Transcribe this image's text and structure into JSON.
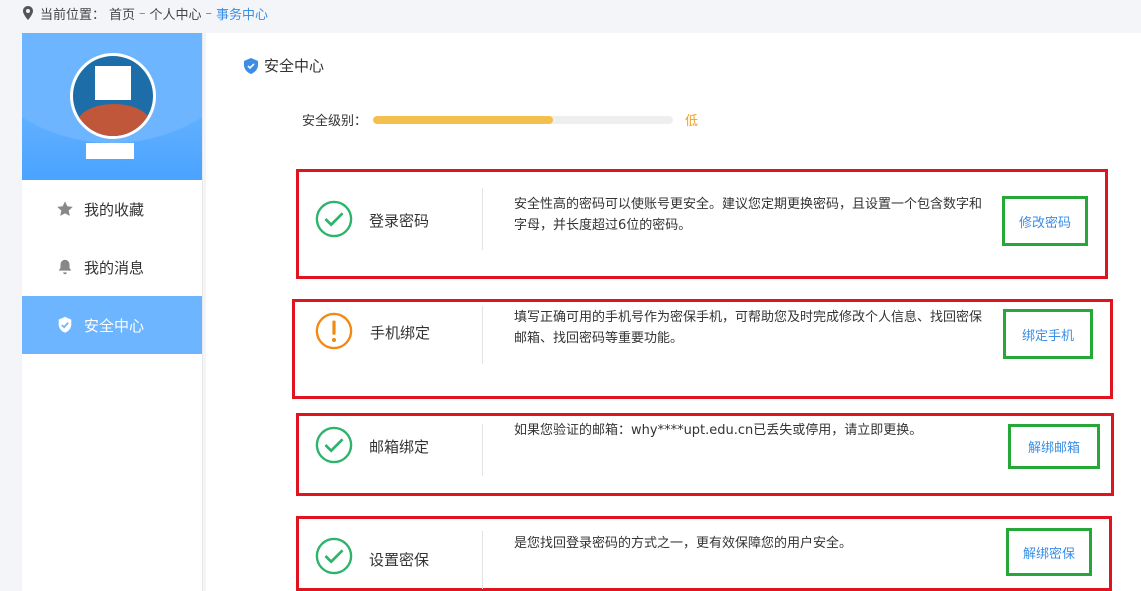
{
  "breadcrumb": {
    "prefix": "当前位置：",
    "home": "首页",
    "sep": "–",
    "personal": "个人中心",
    "current": "事务中心"
  },
  "sidebar": {
    "items": [
      {
        "label": "我的收藏",
        "icon": "star-icon"
      },
      {
        "label": "我的消息",
        "icon": "bell-icon"
      },
      {
        "label": "安全中心",
        "icon": "shield-icon"
      }
    ]
  },
  "main": {
    "title": "安全中心",
    "level_label": "安全级别：",
    "level_value": "低",
    "level_percent": 60,
    "items": [
      {
        "name": "登录密码",
        "status": "ok",
        "desc": "安全性高的密码可以使账号更安全。建议您定期更换密码，且设置一个包含数字和字母，并长度超过6位的密码。",
        "action": "修改密码"
      },
      {
        "name": "手机绑定",
        "status": "warning",
        "desc": "填写正确可用的手机号作为密保手机，可帮助您及时完成修改个人信息、找回密保邮箱、找回密码等重要功能。",
        "action": "绑定手机"
      },
      {
        "name": "邮箱绑定",
        "status": "ok",
        "desc": "如果您验证的邮箱：why****upt.edu.cn已丢失或停用，请立即更换。",
        "action": "解绑邮箱"
      },
      {
        "name": "设置密保",
        "status": "ok",
        "desc": "是您找回登录密码的方式之一，更有效保障您的用户安全。",
        "action": "解绑密保"
      }
    ]
  },
  "colors": {
    "accent": "#6db6ff",
    "ok": "#2db36a",
    "warning": "#f08a14",
    "link": "#3a8ee6"
  }
}
